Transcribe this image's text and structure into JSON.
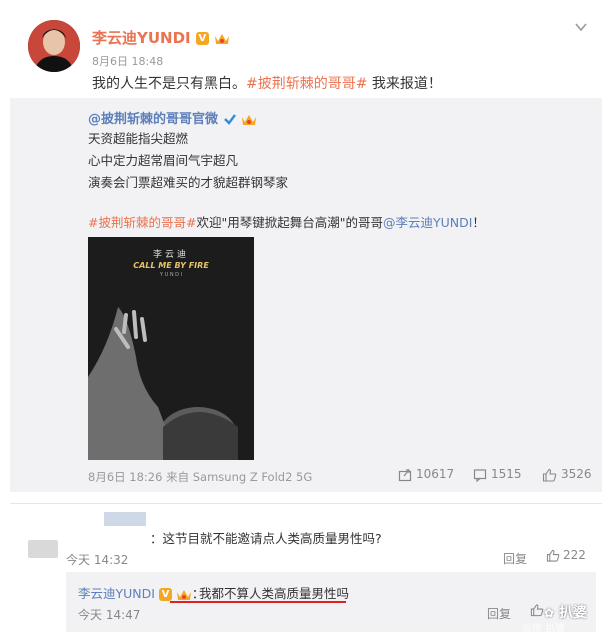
{
  "post": {
    "username": "李云迪YUNDI",
    "time": "8月6日 18:48",
    "text_plain": "我的人生不是只有黑白。",
    "hashtag": "#披荆斩棘的哥哥#",
    "text_end": " 我来报道！"
  },
  "original": {
    "username": "@披荆斩棘的哥哥官微",
    "lines": [
      "天资超能指尖超燃",
      "心中定力超常眉间气宇超凡",
      "演奏会门票超难买的才貌超群钢琴家"
    ],
    "tag": "#披荆斩棘的哥哥#",
    "tag_text": "欢迎\"用琴键掀起舞台高潮\"的哥哥",
    "mention": "@李云迪YUNDI",
    "tag_end": "！",
    "poster_name": "李云迪",
    "poster_title": "CALL ME BY FIRE",
    "poster_sub": "Y U N D I",
    "meta": "8月6日 18:26 来自 Samsung Z Fold2 5G",
    "reposts": "10617",
    "comments": "1515",
    "likes": "3526"
  },
  "comment": {
    "text": "：这节目就不能邀请点人类高质量男性吗?",
    "time": "今天 14:32",
    "reply_label": "回复",
    "likes": "222"
  },
  "reply": {
    "username": "李云迪YUNDI",
    "text": "我都不算人类高质量男性吗",
    "time": "今天 14:47",
    "reply_label": "回复"
  },
  "watermark": {
    "main": "扒婆",
    "sub": "百度 扒婆"
  },
  "colors": {
    "orange_link": "#eb7350",
    "blue_link": "#5d7fbb",
    "repost_bg": "#f2f2f5",
    "underline": "#e02020"
  }
}
